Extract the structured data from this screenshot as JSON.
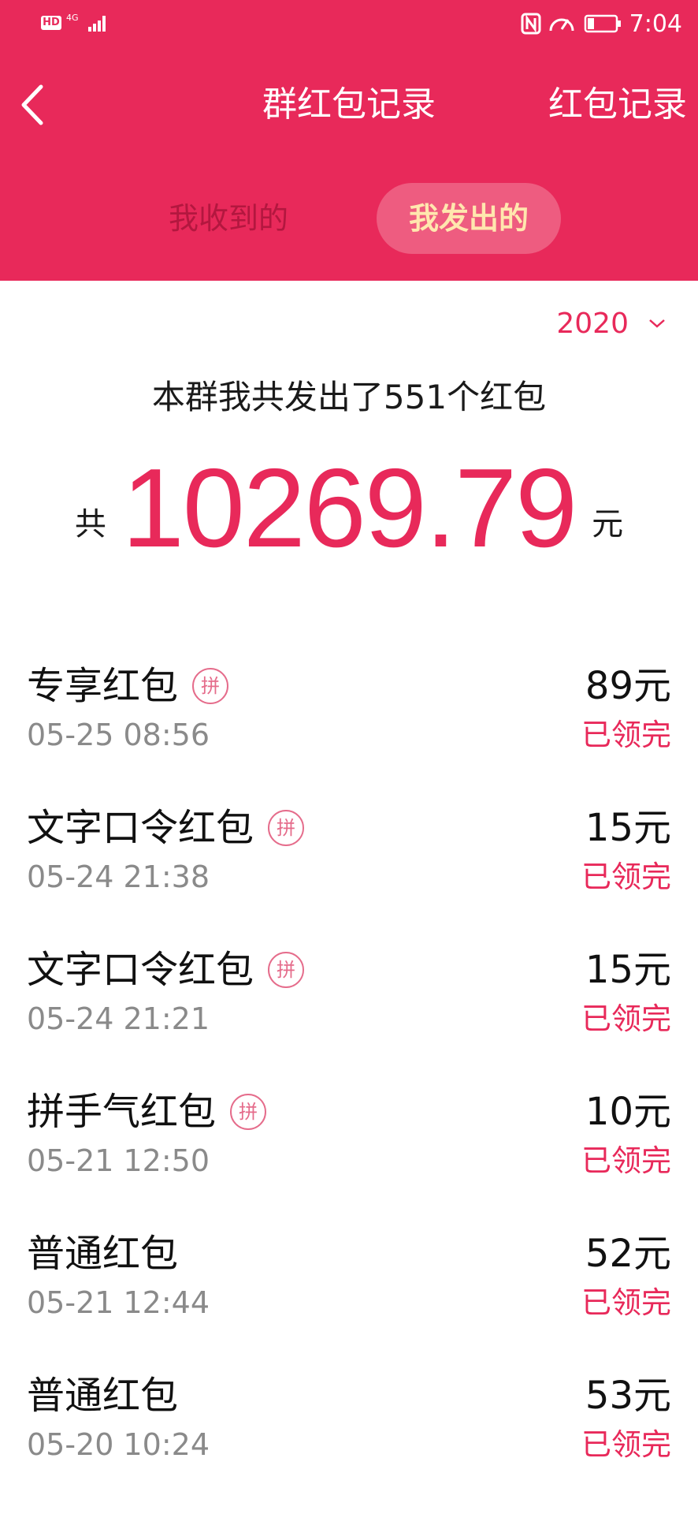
{
  "status_bar": {
    "hd": "HD",
    "network": "4G",
    "time": "7:04"
  },
  "nav": {
    "title": "群红包记录",
    "right_link": "红包记录"
  },
  "tabs": [
    {
      "label": "我收到的",
      "active": false
    },
    {
      "label": "我发出的",
      "active": true
    }
  ],
  "year_filter": "2020",
  "summary": {
    "text": "本群我共发出了551个红包",
    "total_prefix": "共",
    "total_amount": "10269.79",
    "total_suffix": "元"
  },
  "records": [
    {
      "name": "专享红包",
      "badge": "拼",
      "time": "05-25 08:56",
      "amount": "89元",
      "status": "已领完"
    },
    {
      "name": "文字口令红包",
      "badge": "拼",
      "time": "05-24 21:38",
      "amount": "15元",
      "status": "已领完"
    },
    {
      "name": "文字口令红包",
      "badge": "拼",
      "time": "05-24 21:21",
      "amount": "15元",
      "status": "已领完"
    },
    {
      "name": "拼手气红包",
      "badge": "拼",
      "time": "05-21 12:50",
      "amount": "10元",
      "status": "已领完"
    },
    {
      "name": "普通红包",
      "badge": null,
      "time": "05-21 12:44",
      "amount": "52元",
      "status": "已领完"
    },
    {
      "name": "普通红包",
      "badge": null,
      "time": "05-20 10:24",
      "amount": "53元",
      "status": "已领完"
    }
  ],
  "colors": {
    "brand": "#e8295a",
    "tab_active_bg": "#ee5c80",
    "tab_active_text": "#ffe7ae",
    "muted_text": "#8a8a8a"
  }
}
